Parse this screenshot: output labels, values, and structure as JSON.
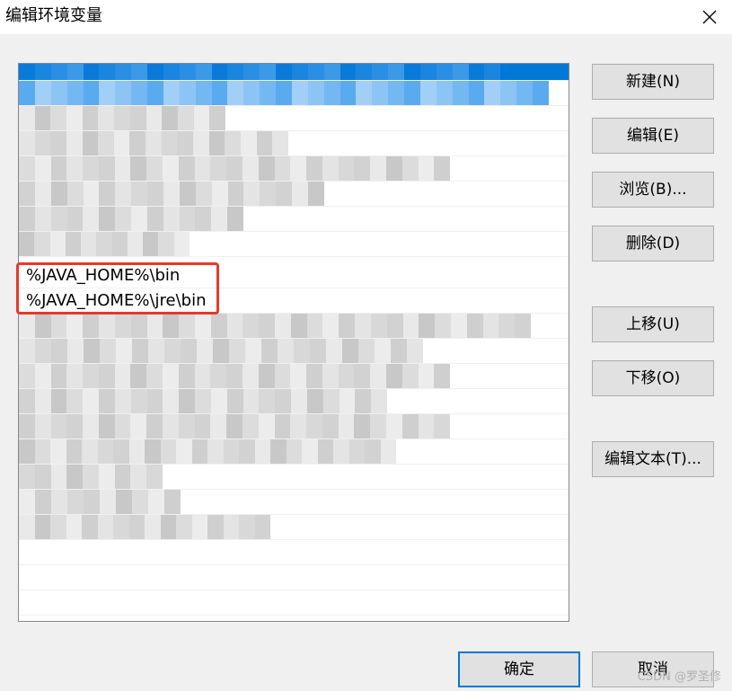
{
  "window": {
    "title": "编辑环境变量"
  },
  "list": {
    "items": [
      {
        "text": "",
        "obscured": true,
        "selected": true
      },
      {
        "text": "",
        "obscured": true
      },
      {
        "text": "",
        "obscured": true
      },
      {
        "text": "",
        "obscured": true
      },
      {
        "text": "",
        "obscured": true
      },
      {
        "text": "",
        "obscured": true
      },
      {
        "text": "",
        "obscured": true
      },
      {
        "text": "",
        "obscured": true
      },
      {
        "text": "%JAVA_HOME%\\bin",
        "obscured": false
      },
      {
        "text": "%JAVA_HOME%\\jre\\bin",
        "obscured": false
      },
      {
        "text": "",
        "obscured": true
      },
      {
        "text": "",
        "obscured": true
      },
      {
        "text": "",
        "obscured": true
      },
      {
        "text": "",
        "obscured": true
      },
      {
        "text": "",
        "obscured": true
      },
      {
        "text": "",
        "obscured": true
      },
      {
        "text": "",
        "obscured": true
      },
      {
        "text": "",
        "obscured": true
      },
      {
        "text": "",
        "obscured": true
      },
      {
        "text": "",
        "obscured": false
      },
      {
        "text": "",
        "obscured": false
      },
      {
        "text": "",
        "obscured": false
      }
    ]
  },
  "buttons": {
    "new": "新建(N)",
    "edit": "编辑(E)",
    "browse": "浏览(B)...",
    "delete": "删除(D)",
    "move_up": "上移(U)",
    "move_down": "下移(O)",
    "edit_text": "编辑文本(T)...",
    "ok": "确定",
    "cancel": "取消"
  },
  "watermark": "CSDN @罗圣修",
  "colors": {
    "selection": "#0078d7",
    "highlight_border": "#e6392b",
    "dialog_background": "#f0f0f0"
  }
}
